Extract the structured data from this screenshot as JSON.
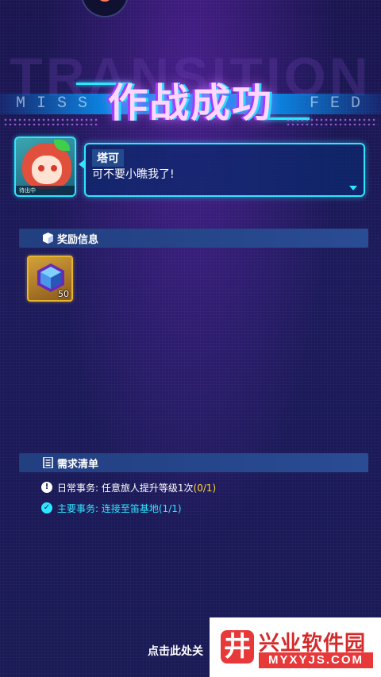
{
  "banner": {
    "title": "作战成功",
    "ghost_text": "TRANSITION",
    "strip_left": "MISS",
    "strip_right": "FED"
  },
  "dialogue": {
    "speaker": "塔可",
    "text": "可不要小瞧我了!",
    "portrait_tag": "待出中"
  },
  "rewards": {
    "header": "奖励信息",
    "items": [
      {
        "icon": "cube-gem-icon",
        "quantity": "50"
      }
    ]
  },
  "requirements": {
    "header": "需求清单",
    "tasks": [
      {
        "label": "日常事务:",
        "text": "任意旅人提升等级1次",
        "progress": "(0/1)",
        "status": "incomplete"
      },
      {
        "label": "主要事务:",
        "text": "连接至笛基地(1/1)",
        "status": "complete"
      }
    ]
  },
  "close_hint": "点击此处关",
  "watermark": {
    "logo_char": "井",
    "title": "兴业软件园",
    "domain": "MYXYJS.COM"
  },
  "colors": {
    "accent_cyan": "#2ee6ff",
    "progress_yellow": "#ffd43a",
    "section_blue": "#2a4c94",
    "reward_gold": "#e6b530"
  }
}
